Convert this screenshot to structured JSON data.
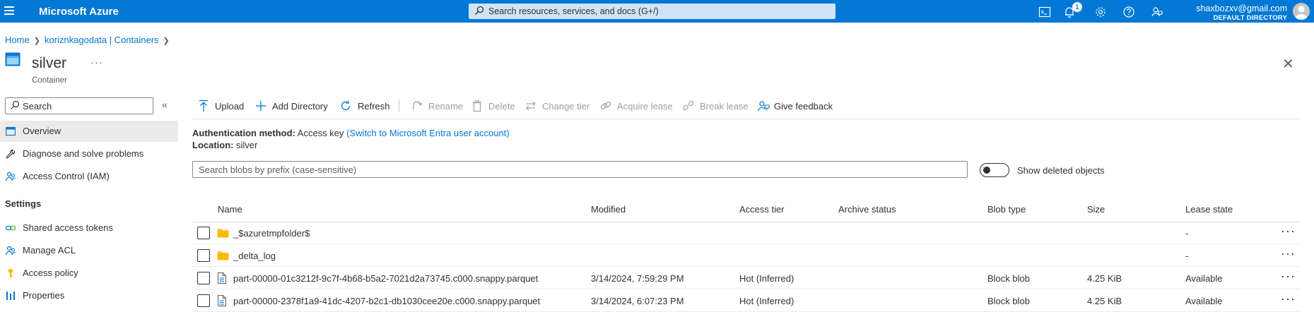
{
  "topbar": {
    "brand": "Microsoft Azure",
    "search_placeholder": "Search resources, services, and docs (G+/)",
    "notification_count": "1",
    "user_email": "shaxbozxv@gmail.com",
    "user_directory": "DEFAULT DIRECTORY"
  },
  "breadcrumb": {
    "home": "Home",
    "parent": "koriznkagodata | Containers"
  },
  "page": {
    "title": "silver",
    "subtitle": "Container",
    "more": "···",
    "close": "✕"
  },
  "nav": {
    "search_placeholder": "Search",
    "collapse": "«",
    "items": [
      {
        "label": "Overview",
        "icon": "overview-icon",
        "active": true
      },
      {
        "label": "Diagnose and solve problems",
        "icon": "wrench-icon"
      },
      {
        "label": "Access Control (IAM)",
        "icon": "people-icon"
      }
    ],
    "settings_heading": "Settings",
    "settings_items": [
      {
        "label": "Shared access tokens",
        "icon": "link-icon"
      },
      {
        "label": "Manage ACL",
        "icon": "people-icon"
      },
      {
        "label": "Access policy",
        "icon": "key-icon"
      },
      {
        "label": "Properties",
        "icon": "bars-icon"
      }
    ]
  },
  "commands": {
    "upload": "Upload",
    "add_directory": "Add Directory",
    "refresh": "Refresh",
    "rename": "Rename",
    "delete": "Delete",
    "change_tier": "Change tier",
    "acquire_lease": "Acquire lease",
    "break_lease": "Break lease",
    "give_feedback": "Give feedback"
  },
  "info": {
    "auth_label": "Authentication method:",
    "auth_value": "Access key",
    "auth_link": "(Switch to Microsoft Entra user account)",
    "location_label": "Location:",
    "location_value": "silver"
  },
  "blob_search": {
    "placeholder": "Search blobs by prefix (case-sensitive)",
    "toggle_label": "Show deleted objects"
  },
  "table": {
    "headers": {
      "name": "Name",
      "modified": "Modified",
      "access_tier": "Access tier",
      "archive_status": "Archive status",
      "blob_type": "Blob type",
      "size": "Size",
      "lease_state": "Lease state"
    },
    "rows": [
      {
        "type": "folder",
        "name": "_$azuretmpfolder$",
        "modified": "",
        "access_tier": "",
        "archive_status": "",
        "blob_type": "",
        "size": "",
        "lease_state": "-"
      },
      {
        "type": "folder",
        "name": "_delta_log",
        "modified": "",
        "access_tier": "",
        "archive_status": "",
        "blob_type": "",
        "size": "",
        "lease_state": "-"
      },
      {
        "type": "file",
        "name": "part-00000-01c3212f-9c7f-4b68-b5a2-7021d2a73745.c000.snappy.parquet",
        "modified": "3/14/2024, 7:59:29 PM",
        "access_tier": "Hot (Inferred)",
        "archive_status": "",
        "blob_type": "Block blob",
        "size": "4.25 KiB",
        "lease_state": "Available"
      },
      {
        "type": "file",
        "name": "part-00000-2378f1a9-41dc-4207-b2c1-db1030cee20e.c000.snappy.parquet",
        "modified": "3/14/2024, 6:07:23 PM",
        "access_tier": "Hot (Inferred)",
        "archive_status": "",
        "blob_type": "Block blob",
        "size": "4.25 KiB",
        "lease_state": "Available"
      }
    ],
    "row_more": "···"
  }
}
